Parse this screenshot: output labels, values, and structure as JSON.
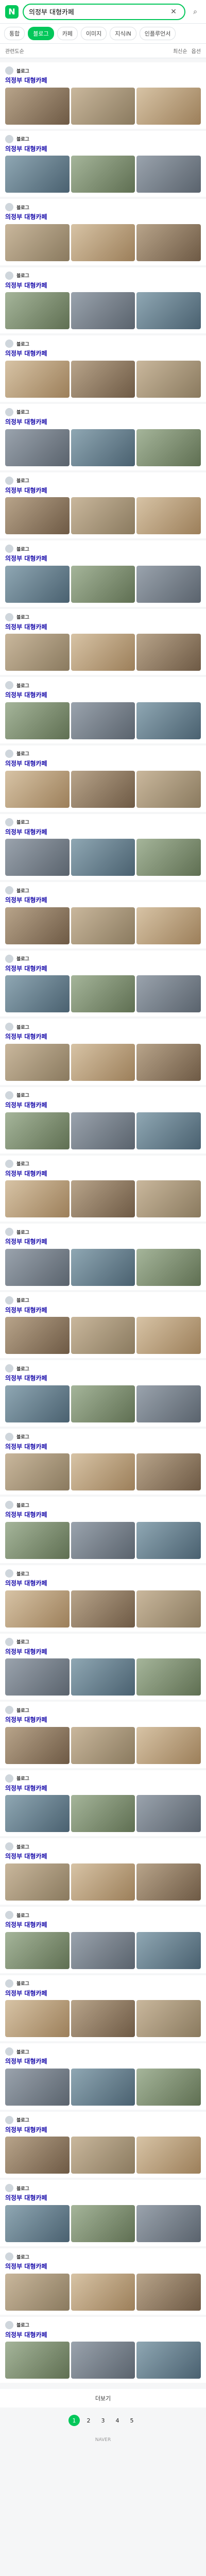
{
  "header": {
    "logo": "N",
    "query": "의정부 대형카페"
  },
  "tabs": [
    {
      "label": "통합"
    },
    {
      "label": "블로그"
    },
    {
      "label": "카페"
    },
    {
      "label": "이미지"
    },
    {
      "label": "지식iN"
    },
    {
      "label": "인플루언서"
    }
  ],
  "filters": {
    "left": "관련도순",
    "right1": "최신순",
    "right2": "옵션"
  },
  "posts": [
    {
      "blog": "블로그",
      "date": "",
      "title": "의정부 대형카페",
      "desc": ""
    },
    {
      "blog": "블로그",
      "date": "",
      "title": "의정부 대형카페",
      "desc": ""
    },
    {
      "blog": "블로그",
      "date": "",
      "title": "의정부 대형카페",
      "desc": ""
    },
    {
      "blog": "블로그",
      "date": "",
      "title": "의정부 대형카페",
      "desc": ""
    },
    {
      "blog": "블로그",
      "date": "",
      "title": "의정부 대형카페",
      "desc": ""
    },
    {
      "blog": "블로그",
      "date": "",
      "title": "의정부 대형카페",
      "desc": ""
    },
    {
      "blog": "블로그",
      "date": "",
      "title": "의정부 대형카페",
      "desc": ""
    },
    {
      "blog": "블로그",
      "date": "",
      "title": "의정부 대형카페",
      "desc": ""
    },
    {
      "blog": "블로그",
      "date": "",
      "title": "의정부 대형카페",
      "desc": ""
    },
    {
      "blog": "블로그",
      "date": "",
      "title": "의정부 대형카페",
      "desc": ""
    },
    {
      "blog": "블로그",
      "date": "",
      "title": "의정부 대형카페",
      "desc": ""
    },
    {
      "blog": "블로그",
      "date": "",
      "title": "의정부 대형카페",
      "desc": ""
    },
    {
      "blog": "블로그",
      "date": "",
      "title": "의정부 대형카페",
      "desc": ""
    },
    {
      "blog": "블로그",
      "date": "",
      "title": "의정부 대형카페",
      "desc": ""
    },
    {
      "blog": "블로그",
      "date": "",
      "title": "의정부 대형카페",
      "desc": ""
    },
    {
      "blog": "블로그",
      "date": "",
      "title": "의정부 대형카페",
      "desc": ""
    },
    {
      "blog": "블로그",
      "date": "",
      "title": "의정부 대형카페",
      "desc": ""
    },
    {
      "blog": "블로그",
      "date": "",
      "title": "의정부 대형카페",
      "desc": ""
    },
    {
      "blog": "블로그",
      "date": "",
      "title": "의정부 대형카페",
      "desc": ""
    },
    {
      "blog": "블로그",
      "date": "",
      "title": "의정부 대형카페",
      "desc": ""
    },
    {
      "blog": "블로그",
      "date": "",
      "title": "의정부 대형카페",
      "desc": ""
    },
    {
      "blog": "블로그",
      "date": "",
      "title": "의정부 대형카페",
      "desc": ""
    },
    {
      "blog": "블로그",
      "date": "",
      "title": "의정부 대형카페",
      "desc": ""
    },
    {
      "blog": "블로그",
      "date": "",
      "title": "의정부 대형카페",
      "desc": ""
    },
    {
      "blog": "블로그",
      "date": "",
      "title": "의정부 대형카페",
      "desc": ""
    },
    {
      "blog": "블로그",
      "date": "",
      "title": "의정부 대형카페",
      "desc": ""
    },
    {
      "blog": "블로그",
      "date": "",
      "title": "의정부 대형카페",
      "desc": ""
    },
    {
      "blog": "블로그",
      "date": "",
      "title": "의정부 대형카페",
      "desc": ""
    },
    {
      "blog": "블로그",
      "date": "",
      "title": "의정부 대형카페",
      "desc": ""
    },
    {
      "blog": "블로그",
      "date": "",
      "title": "의정부 대형카페",
      "desc": ""
    },
    {
      "blog": "블로그",
      "date": "",
      "title": "의정부 대형카페",
      "desc": ""
    },
    {
      "blog": "블로그",
      "date": "",
      "title": "의정부 대형카페",
      "desc": ""
    },
    {
      "blog": "블로그",
      "date": "",
      "title": "의정부 대형카페",
      "desc": ""
    },
    {
      "blog": "블로그",
      "date": "",
      "title": "의정부 대형카페",
      "desc": ""
    }
  ],
  "more": "더보기",
  "pager": [
    "1",
    "2",
    "3",
    "4",
    "5"
  ],
  "footer": "NAVER"
}
